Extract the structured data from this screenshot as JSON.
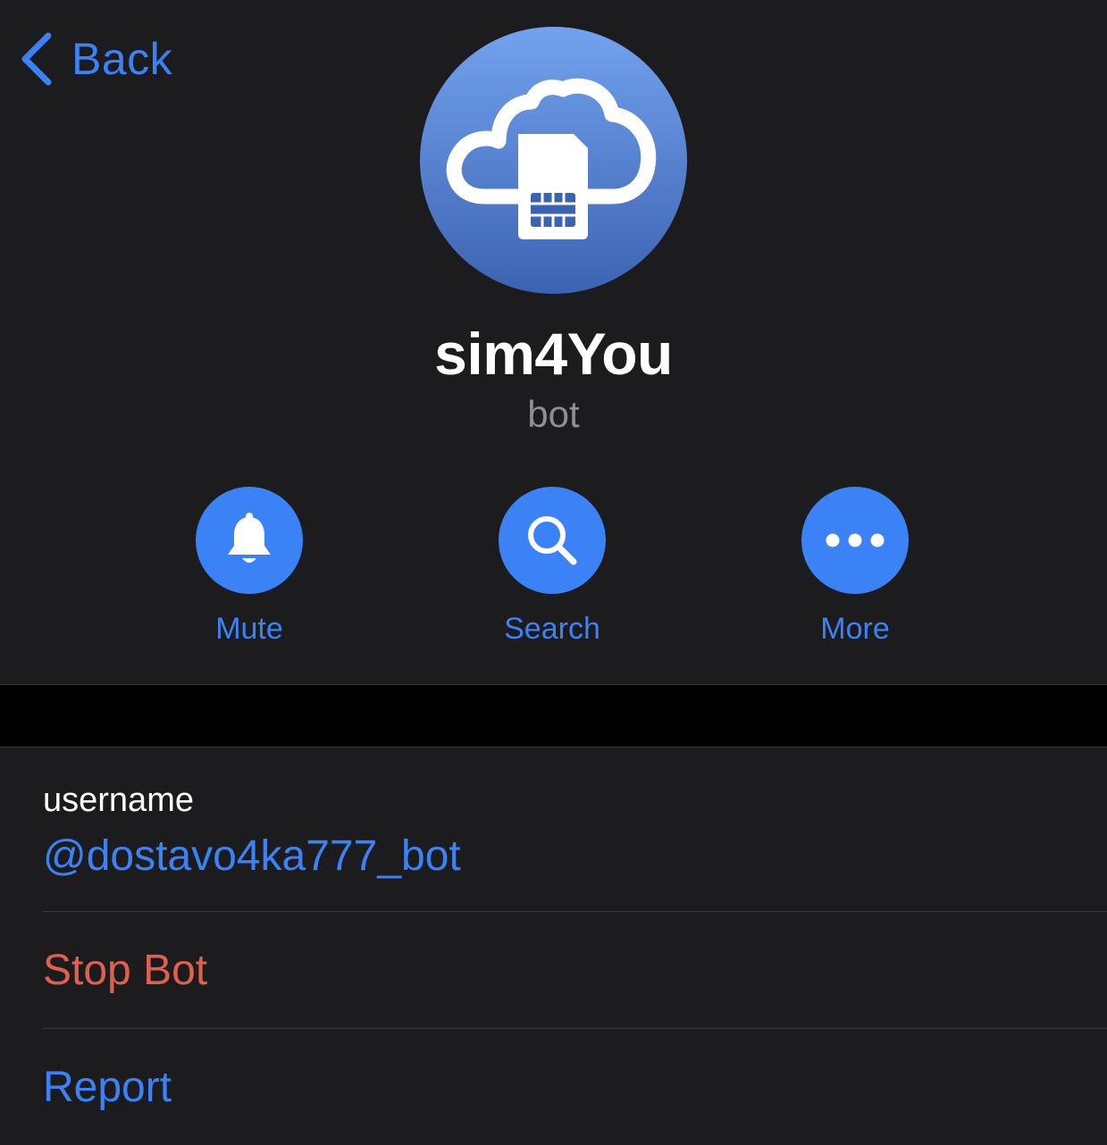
{
  "nav": {
    "back_label": "Back"
  },
  "profile": {
    "name": "sim4You",
    "subtitle": "bot",
    "avatar_icon": "cloud-sim-card-icon"
  },
  "actions": [
    {
      "label": "Mute",
      "icon": "bell-icon"
    },
    {
      "label": "Search",
      "icon": "search-icon"
    },
    {
      "label": "More",
      "icon": "more-dots-icon"
    }
  ],
  "info": {
    "username_caption": "username",
    "username_value": "@dostavo4ka777_bot"
  },
  "menu": {
    "stop_bot_label": "Stop Bot",
    "report_label": "Report"
  },
  "colors": {
    "accent": "#3b82f6",
    "destructive": "#e0604f",
    "background": "#1c1c1e",
    "secondary_text": "#8e8e93"
  }
}
